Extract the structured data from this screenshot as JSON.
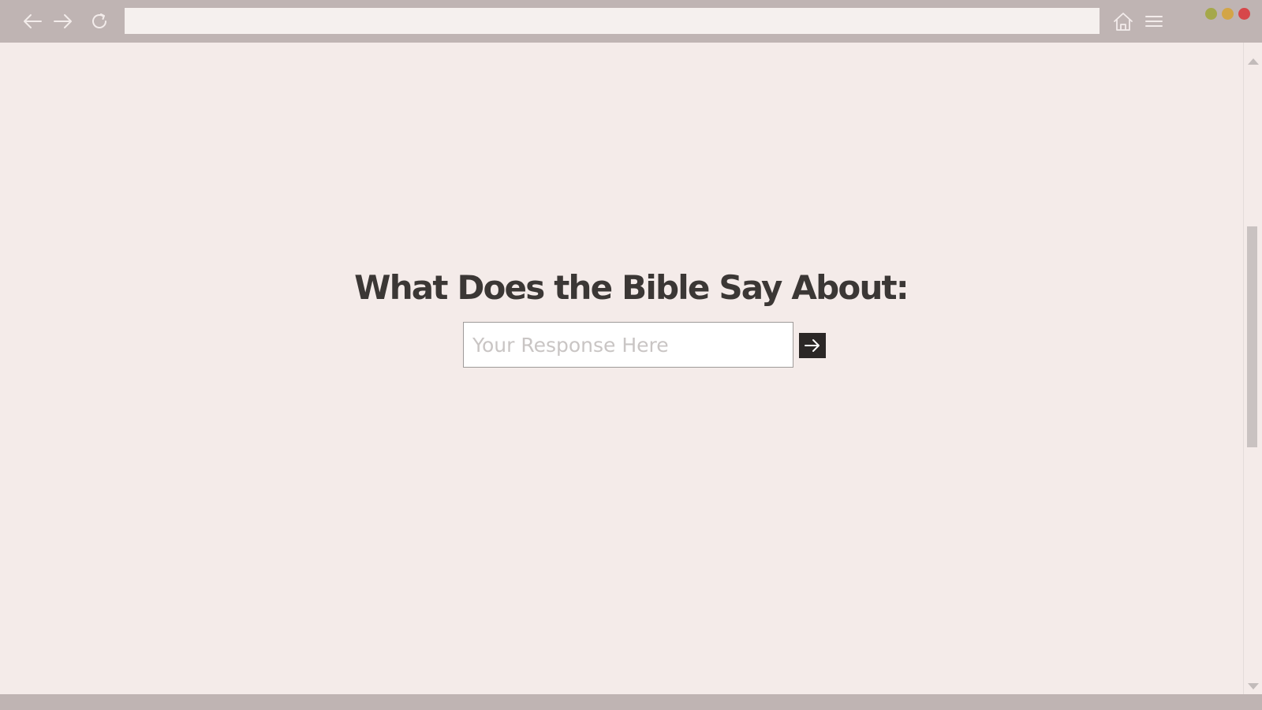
{
  "browser": {
    "address_value": "",
    "icons": {
      "back": "arrow-left-icon",
      "forward": "arrow-right-icon",
      "reload": "reload-icon",
      "home": "home-icon",
      "menu": "hamburger-menu-icon"
    },
    "window_controls": {
      "minimize_color": "#a5a84a",
      "maximize_color": "#d3a546",
      "close_color": "#d7474a"
    },
    "toolbar_color": "#bfb4b3"
  },
  "page": {
    "headline": "What Does the Bible Say About:",
    "response_input": {
      "value": "",
      "placeholder": "Your Response Here"
    },
    "submit_icon": "arrow-right-icon",
    "background_color": "#f4ebe9",
    "text_color": "#3b3735"
  }
}
